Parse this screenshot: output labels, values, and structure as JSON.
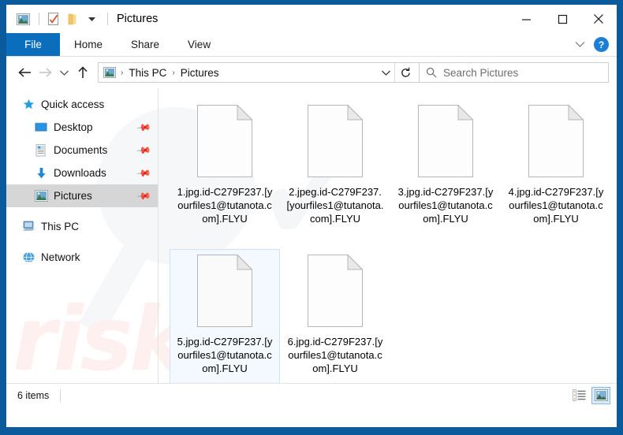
{
  "window": {
    "title": "Pictures",
    "frame_color": "#0a5a9c",
    "quick_access": [
      {
        "name": "pictures-folder-icon",
        "label": "Pictures"
      },
      {
        "name": "properties-icon",
        "label": "Properties"
      },
      {
        "name": "new-folder-icon",
        "label": "New folder"
      },
      {
        "name": "customize-quick-access-chevron-icon",
        "label": "Customize Quick Access Toolbar"
      }
    ],
    "controls": {
      "minimize": "–",
      "maximize": "❐",
      "close": "✕"
    }
  },
  "ribbon": {
    "tabs": [
      {
        "label": "File",
        "active": true
      },
      {
        "label": "Home",
        "active": false
      },
      {
        "label": "Share",
        "active": false
      },
      {
        "label": "View",
        "active": false
      }
    ],
    "expand_chevron": "∨",
    "help_label": "?",
    "file_tab_color": "#0b6ebd"
  },
  "address": {
    "back_label": "←",
    "forward_label": "→",
    "recent_label": "∨",
    "up_label": "↑",
    "breadcrumb": [
      "This PC",
      "Pictures"
    ],
    "separator": "›",
    "dropdown": "∨",
    "refresh": "↻"
  },
  "search": {
    "placeholder": "Search Pictures",
    "icon": "search-icon"
  },
  "sidebar": {
    "items": [
      {
        "label": "Quick access",
        "icon": "star-icon",
        "child": false,
        "pinned": false,
        "selected": false
      },
      {
        "label": "Desktop",
        "icon": "desktop-icon",
        "child": true,
        "pinned": true,
        "selected": false
      },
      {
        "label": "Documents",
        "icon": "documents-icon",
        "child": true,
        "pinned": true,
        "selected": false
      },
      {
        "label": "Downloads",
        "icon": "downloads-icon",
        "child": true,
        "pinned": true,
        "selected": false
      },
      {
        "label": "Pictures",
        "icon": "pictures-icon",
        "child": true,
        "pinned": true,
        "selected": true
      },
      {
        "label": "This PC",
        "icon": "this-pc-icon",
        "child": false,
        "pinned": false,
        "selected": false
      },
      {
        "label": "Network",
        "icon": "network-icon",
        "child": false,
        "pinned": false,
        "selected": false
      }
    ]
  },
  "files": [
    {
      "name": "1.jpg.id-C279F237.[yourfiles1@tutanota.com].FLYU",
      "selected": false
    },
    {
      "name": "2.jpeg.id-C279F237.[yourfiles1@tutanota.com].FLYU",
      "selected": false
    },
    {
      "name": "3.jpg.id-C279F237.[yourfiles1@tutanota.com].FLYU",
      "selected": false
    },
    {
      "name": "4.jpg.id-C279F237.[yourfiles1@tutanota.com].FLYU",
      "selected": false
    },
    {
      "name": "5.jpg.id-C279F237.[yourfiles1@tutanota.com].FLYU",
      "selected": true
    },
    {
      "name": "6.jpg.id-C279F237.[yourfiles1@tutanota.com].FLYU",
      "selected": false
    }
  ],
  "status": {
    "item_count": "6 items",
    "views": [
      {
        "name": "details-view-button",
        "active": false
      },
      {
        "name": "large-icons-view-button",
        "active": true
      }
    ]
  },
  "watermark": {
    "text": "risk"
  }
}
